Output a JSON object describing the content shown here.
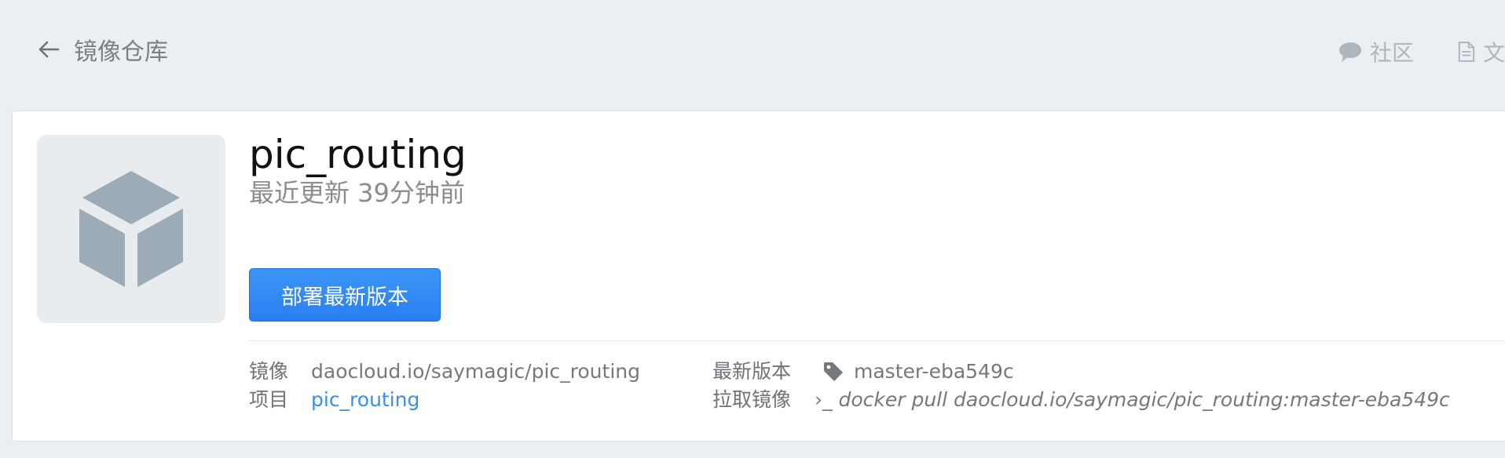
{
  "header": {
    "back_label": "镜像仓库",
    "nav": [
      {
        "label": "社区",
        "icon": "comment-icon"
      },
      {
        "label": "文",
        "icon": "document-icon"
      }
    ]
  },
  "repo": {
    "name": "pic_routing",
    "updated": "最近更新 39分钟前",
    "deploy_label": "部署最新版本",
    "thumbnail_icon": "cube-icon"
  },
  "details": {
    "image_label": "镜像",
    "image_value": "daocloud.io/saymagic/pic_routing",
    "project_label": "项目",
    "project_value": "pic_routing",
    "latest_label": "最新版本",
    "latest_value": "master-eba549c",
    "pull_label": "拉取镜像",
    "pull_prompt": "›_",
    "pull_command": "docker pull daocloud.io/saymagic/pic_routing:master-eba549c"
  },
  "colors": {
    "background": "#eceff1",
    "primary_button": "#2a7ff0",
    "link": "#3c8ee6"
  }
}
